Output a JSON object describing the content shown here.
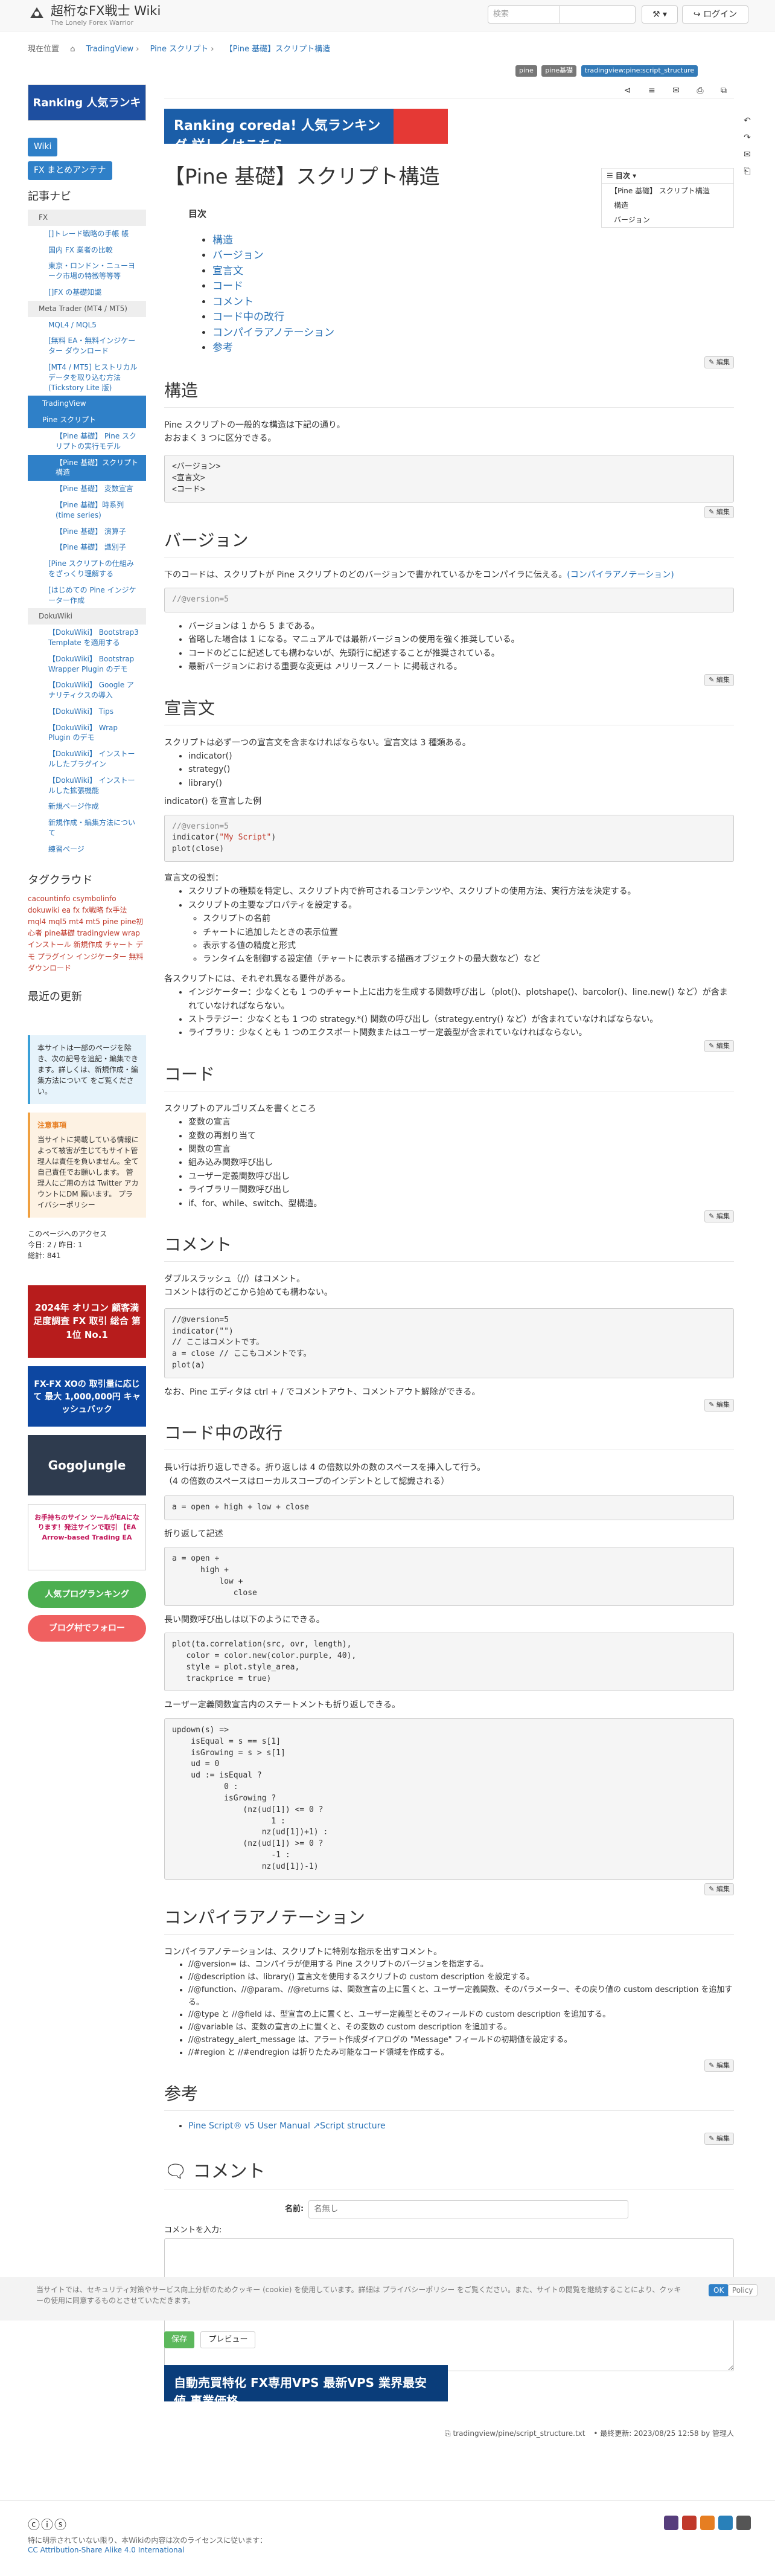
{
  "header": {
    "site_title": "超桁なFX戦士 Wiki",
    "site_tagline": "The Lonely Forex Warrior",
    "search_placeholder": "検索",
    "tools_label": "⚒ ▾",
    "login_label": "↪ ログイン"
  },
  "breadcrumb": [
    "現在位置",
    "⌂",
    "TradingView",
    "Pine スクリプト",
    "【Pine 基礎】スクリプト構造"
  ],
  "tags": [
    "pine",
    "pine基礎",
    "tradingview:pine:script_structure"
  ],
  "sidebar": {
    "top_banner": "Ranking 人気ランキ",
    "wiki_button": "Wiki",
    "antenna_button": "FX まとめアンテナ",
    "nav_heading": "記事ナビ",
    "nav_items": [
      {
        "label": "FX",
        "level": "l1"
      },
      {
        "label": "[]トレード戦略の手帳 帳",
        "level": "l2"
      },
      {
        "label": "国内 FX 業者の比較",
        "level": "l2"
      },
      {
        "label": "東京・ロンドン・ニューヨーク市場の特徴等等等",
        "level": "l2"
      },
      {
        "label": "[]FX の基礎知識",
        "level": "l2"
      },
      {
        "label": "Meta Trader (MT4 / MT5)",
        "level": "l1"
      },
      {
        "label": "MQL4 / MQL5",
        "level": "l2"
      },
      {
        "label": "[無料 EA・無料インジケーター ダウンロード",
        "level": "l2"
      },
      {
        "label": "[MT4 / MT5] ヒストリカルデータを取り込む方法 (Tickstory Lite 版)",
        "level": "l2"
      },
      {
        "label": "TradingView",
        "level": "sel"
      },
      {
        "label": "Pine スクリプト",
        "level": "sel"
      },
      {
        "label": "【Pine 基礎】 Pine スクリプトの実行モデル",
        "level": "l3"
      },
      {
        "label": "【Pine 基礎】スクリプト構造",
        "level": "sel2"
      },
      {
        "label": "【Pine 基礎】 変数宣言",
        "level": "l3"
      },
      {
        "label": "【Pine 基礎】時系列 (time series)",
        "level": "l3"
      },
      {
        "label": "【Pine 基礎】 演算子",
        "level": "l3"
      },
      {
        "label": "【Pine 基礎】 識別子",
        "level": "l3"
      },
      {
        "label": "[Pine スクリプトの仕組みをざっくり理解する",
        "level": "l2"
      },
      {
        "label": "[はじめての Pine インジケーター作成",
        "level": "l2"
      },
      {
        "label": "DokuWiki",
        "level": "l1"
      },
      {
        "label": "【DokuWiki】 Bootstrap3 Template を適用する",
        "level": "l2"
      },
      {
        "label": "【DokuWiki】 Bootstrap Wrapper Plugin のデモ",
        "level": "l2"
      },
      {
        "label": "【DokuWiki】 Google アナリティクスの導入",
        "level": "l2"
      },
      {
        "label": "【DokuWiki】 Tips",
        "level": "l2"
      },
      {
        "label": "【DokuWiki】 Wrap Plugin のデモ",
        "level": "l2"
      },
      {
        "label": "【DokuWiki】 インストールしたプラグイン",
        "level": "l2"
      },
      {
        "label": "【DokuWiki】 インストールした拡張機能",
        "level": "l2"
      },
      {
        "label": "新規ページ作成",
        "level": "l2"
      },
      {
        "label": "新規作成・編集方法について",
        "level": "l2"
      },
      {
        "label": "練習ページ",
        "level": "l2"
      }
    ],
    "tag_heading": "タグクラウド",
    "tag_cloud": "cacountinfo csymbolinfo dokuwiki ea fx fx戦略 fx手法 mql4 mql5 mt4 mt5 pine pine初心者 pine基礎 tradingview wrap インストール 新規作成 チャート デモ プラグイン インジケーター 無料ダウンロード",
    "recent_heading": "最近の更新",
    "notice_blue": "本サイトは一部のページを除き、次の記号を追記・編集できます。詳しくは、新規作成・編集方法について をご覧ください。",
    "notice_orange_title": "注意事項",
    "notice_orange": "当サイトに掲載している情報によって被害が生じてもサイト管理人は責任を負いません。全て自己責任でお願いします。 管理人にご用の方は Twitter アカウントにDM 願います。 プライバシーポリシー",
    "access_heading": "このページへのアクセス",
    "access_today": "今日: 2 / 昨日: 1",
    "access_total": "総計: 841",
    "ad1": "2024年 オリコン 顧客満足度調査 FX 取引 総合 第1位 No.1",
    "ad2": "FX-FX XOの 取引量に応じて 最大 1,000,000円 キャッシュバック",
    "ad3": "GogoJungle",
    "ad4": "お手持ちのサイン ツールがEAになります！発注サインで取引 【EA Arrow-based Trading EA",
    "ad5": "人気プログランキング",
    "ad6": "ブログ村でフォロー"
  },
  "page_tools": [
    "↶",
    "↷",
    "✉",
    "⎗",
    "⎙",
    "↑"
  ],
  "main": {
    "top_banner": "Ranking coreda! 人気ランキング 詳しくはこちら",
    "title": "【Pine 基礎】スクリプト構造",
    "toc_label": "目次",
    "toc_small_title": "☰ 目次 ▾",
    "toc_small": [
      "【Pine 基礎】 スクリプト構造",
      "構造",
      "バージョン"
    ],
    "toc": [
      "構造",
      "バージョン",
      "宣言文",
      "コード",
      "コメント",
      "コード中の改行",
      "コンパイラアノテーション",
      "参考"
    ],
    "edit_label": "✎ 編集",
    "s_structure": {
      "h": "構造",
      "p1": "Pine スクリプトの一般的な構造は下記の通り。",
      "p2": "おおまく 3 つに区分できる。",
      "code": "<バージョン>\n<宣言文>\n<コード>"
    },
    "s_version": {
      "h": "バージョン",
      "p1": "下のコードは、スクリプトが Pine スクリプトのどのバージョンで書かれているかをコンパイラに伝える。",
      "p1_link": "(コンパイラアノテーション)",
      "code": "//@version=5",
      "bullets": [
        "バージョンは 1 から 5 まである。",
        "省略した場合は 1 になる。マニュアルでは最新バージョンの使用を強く推奨している。",
        "コードのどこに記述しても構わないが、先頭行に記述することが推奨されている。",
        "最新バージョンにおける重要な変更は ↗リリースノート に掲載される。"
      ]
    },
    "s_decl": {
      "h": "宣言文",
      "p1": "スクリプトは必ず一つの宣言文を含まなければならない。宣言文は 3 種類ある。",
      "list": [
        "indicator()",
        "strategy()",
        "library()"
      ],
      "p2": "indicator() を宣言した例",
      "code_l1": "//@version=5",
      "code_l2a": "indicator(",
      "code_l2b": "\"My Script\"",
      "code_l2c": ")",
      "code_l3": "plot(close)",
      "p3": "宣言文の役割：",
      "roles": [
        "スクリプトの種類を特定し、スクリプト内で許可されるコンテンツや、スクリプトの使用方法、実行方法を決定する。",
        "スクリプトの主要なプロパティを設定する。"
      ],
      "roles_sub": [
        "スクリプトの名前",
        "チャートに追加したときの表示位置",
        "表示する値の精度と形式",
        "ランタイムを制御する設定値（チャートに表示する描画オブジェクトの最大数など）など"
      ],
      "p4": "各スクリプトには、それぞれ異なる要件がある。",
      "reqs": [
        "インジケーター：少なくとも 1 つのチャート上に出力を生成する関数呼び出し（plot()、plotshape()、barcolor()、line.new() など）が含まれていなければならない。",
        "ストラテジー：少なくとも 1 つの strategy.*() 関数の呼び出し（strategy.entry() など）が含まれていなければならない。",
        "ライブラリ：少なくとも 1 つのエクスポート関数またはユーザー定義型が含まれていなければならない。"
      ]
    },
    "s_code": {
      "h": "コード",
      "p1": "スクリプトのアルゴリズムを書くところ",
      "list": [
        "変数の宣言",
        "変数の再割り当て",
        "関数の宣言",
        "組み込み関数呼び出し",
        "ユーザー定義関数呼び出し",
        "ライブラリー関数呼び出し",
        "if、for、while、switch、型構造。"
      ]
    },
    "s_comment": {
      "h": "コメント",
      "p1": "ダブルスラッシュ（//）はコメント。",
      "p2": "コメントは行のどこから始めても構わない。",
      "code": "//@version=5\nindicator(\"\")\n// ここはコメントです。\na = close // ここもコメントです。\nplot(a)",
      "p3": "なお、Pine エディタは ctrl + / でコメントアウト、コメントアウト解除ができる。"
    },
    "s_break": {
      "h": "コード中の改行",
      "p1": "長い行は折り返しできる。折り返しは 4 の倍数以外の数のスペースを挿入して行う。",
      "p2": "（4 の倍数のスペースはローカルスコープのインデントとして認識される）",
      "code1": "a = open + high + low + close",
      "p3": "折り返して記述",
      "code2": "a = open +\n      high +\n          low +\n             close",
      "p4": "長い関数呼び出しは以下のようにできる。",
      "code3": "plot(ta.correlation(src, ovr, length),\n   color = color.new(color.purple, 40),\n   style = plot.style_area,\n   trackprice = true)",
      "p5": "ユーザー定義関数宣言内のステートメントも折り返しできる。",
      "code4": "updown(s) =>\n    isEqual = s == s[1]\n    isGrowing = s > s[1]\n    ud = 0\n    ud := isEqual ?\n           0 :\n           isGrowing ?\n               (nz(ud[1]) <= 0 ?\n                     1 :\n                   nz(ud[1])+1) :\n               (nz(ud[1]) >= 0 ?\n                     -1 :\n                   nz(ud[1])-1)"
    },
    "s_annot": {
      "h": "コンパイラアノテーション",
      "p1": "コンパイラアノテーションは、スクリプトに特別な指示を出すコメント。",
      "list": [
        "//@version= は、コンパイラが使用する Pine スクリプトのバージョンを指定する。",
        "//@description は、library() 宣言文を使用するスクリプトの custom description を設定する。",
        "//@function、//@param、//@returns は、関数宣言の上に置くと、ユーザー定義関数、そのパラメーター、その戻り値の custom description を追加する。",
        "//@type と //@field は、型宣言の上に置くと、ユーザー定義型とそのフィールドの custom description を追加する。",
        "//@variable は、変数の宣言の上に置くと、その変数の custom description を追加する。",
        "//@strategy_alert_message は、アラート作成ダイアログの \"Message\" フィールドの初期値を設定する。",
        "//#region と //#endregion は折りたたみ可能なコード領域を作成する。"
      ]
    },
    "s_ref": {
      "h": "参考",
      "item": "Pine Script® v5 User Manual ↗Script structure"
    },
    "comment": {
      "h": "コメント",
      "name_label": "名前:",
      "name_placeholder": "名無し",
      "body_label": "コメントを入力:",
      "save_label": "保存",
      "preview_label": "プレビュー"
    },
    "bottom_banner": "自動売買特化 FX専用VPS 最新VPS 業界最安値 事業価格",
    "page_id": "⎘ tradingview/pine/script_structure.txt",
    "last_update": "• 最終更新: 2023/08/25 12:58 by 管理人"
  },
  "cookie": {
    "text": "当サイトでは、セキュリティ対策やサービス向上分析のためクッキー (cookie) を使用しています。詳細は プライバシーポリシー をご覧ください。また、サイトの閲覧を継続することにより、クッキーの使用に同意するものとさせていただきます。",
    "ok": "OK",
    "policy": "Policy"
  },
  "footer": {
    "license_1": "特に明示されていない限り、本Wikiの内容は次のライセンスに従います：",
    "license_2": "CC Attribution-Share Alike 4.0 International"
  }
}
